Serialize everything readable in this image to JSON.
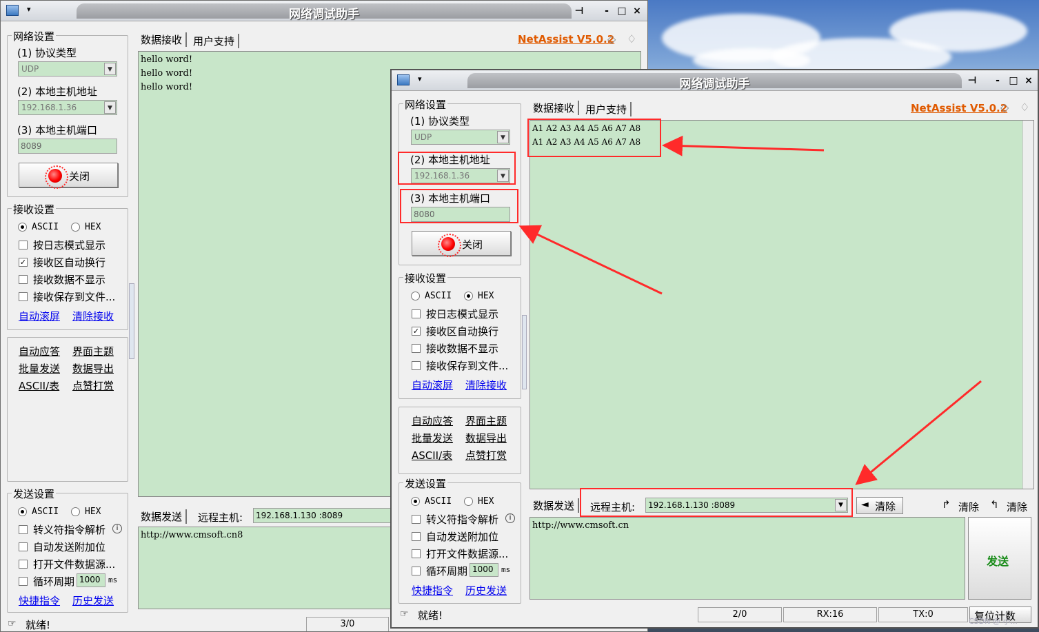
{
  "app": {
    "title": "网络调试助手",
    "brand": "NetAssist V5.0.2",
    "menu_arrow": "▾",
    "pin_symbol": "⊣",
    "minimize_symbol": "-",
    "maximize_symbol": "□",
    "close_symbol": "×"
  },
  "colors": {
    "area_bg": "#c8e6c9",
    "brand": "#e05a00",
    "annotation_red": "#ff2a2a",
    "link": "#0000ee",
    "send_green": "#1a8c1a"
  },
  "icons": [
    "app-icon",
    "pin-icon",
    "diamond-icon",
    "bell-icon",
    "red-led-icon",
    "status-icon",
    "clear-icon"
  ],
  "back_window": {
    "net_group": "网络设置",
    "protocol_label": "(1) 协议类型",
    "protocol_value": "UDP",
    "host_label": "(2) 本地主机地址",
    "host_value": "192.168.1.36",
    "port_label": "(3) 本地主机端口",
    "port_value": "8089",
    "close_button": "关闭",
    "recv_group": "接收设置",
    "recv_ascii": "ASCII",
    "recv_hex": "HEX",
    "log_mode": "按日志模式显示",
    "auto_wrap": "接收区自动换行",
    "no_display": "接收数据不显示",
    "save_to_file": "接收保存到文件...",
    "auto_scroll": "自动滚屏",
    "clear_recv": "清除接收",
    "tools": [
      "自动应答",
      "界面主题",
      "批量发送",
      "数据导出",
      "ASCII/表",
      "点赞打赏"
    ],
    "send_group": "发送设置",
    "send_ascii": "ASCII",
    "send_hex": "HEX",
    "escape_parse": "转义符指令解析",
    "auto_append": "自动发送附加位",
    "open_file": "打开文件数据源...",
    "loop_period": "循环周期",
    "loop_value": "1000",
    "loop_unit": "ms",
    "quick_cmd": "快捷指令",
    "history": "历史发送",
    "tab_recv": "数据接收",
    "tab_support": "用户支持",
    "received_lines": [
      "hello word!",
      "hello word!",
      "hello word!"
    ],
    "tab_send": "数据发送",
    "remote_label": "远程主机:",
    "remote_value": "192.168.1.130 :8089",
    "send_text": "http://www.cmsoft.cn8",
    "status": "就绪!",
    "counter": "3/0"
  },
  "front_window": {
    "net_group": "网络设置",
    "protocol_label": "(1) 协议类型",
    "protocol_value": "UDP",
    "host_label": "(2) 本地主机地址",
    "host_value": "192.168.1.36",
    "port_label": "(3) 本地主机端口",
    "port_value": "8080",
    "close_button": "关闭",
    "recv_group": "接收设置",
    "recv_ascii": "ASCII",
    "recv_hex": "HEX",
    "log_mode": "按日志模式显示",
    "auto_wrap": "接收区自动换行",
    "no_display": "接收数据不显示",
    "save_to_file": "接收保存到文件...",
    "auto_scroll": "自动滚屏",
    "clear_recv": "清除接收",
    "tools": [
      "自动应答",
      "界面主题",
      "批量发送",
      "数据导出",
      "ASCII/表",
      "点赞打赏"
    ],
    "send_group": "发送设置",
    "send_ascii": "ASCII",
    "send_hex": "HEX",
    "escape_parse": "转义符指令解析",
    "auto_append": "自动发送附加位",
    "open_file": "打开文件数据源...",
    "loop_period": "循环周期",
    "loop_value": "1000",
    "loop_unit": "ms",
    "quick_cmd": "快捷指令",
    "history": "历史发送",
    "tab_recv": "数据接收",
    "tab_support": "用户支持",
    "received_lines": [
      "A1 A2 A3 A4 A5 A6 A7 A8",
      "A1 A2 A3 A4 A5 A6 A7 A8"
    ],
    "tab_send": "数据发送",
    "remote_label": "远程主机:",
    "remote_value": "192.168.1.130 :8089",
    "clear_btn": "清除",
    "clear_recv_count": "清除",
    "clear_send_count": "清除",
    "send_text": "http://www.cmsoft.cn",
    "send_button": "发送",
    "status": "就绪!",
    "counter": "2/0",
    "rx": "RX:16",
    "tx": "TX:0",
    "reset_count": "复位计数"
  },
  "watermark": "CSDN @ 小...",
  "info_symbol": "i"
}
